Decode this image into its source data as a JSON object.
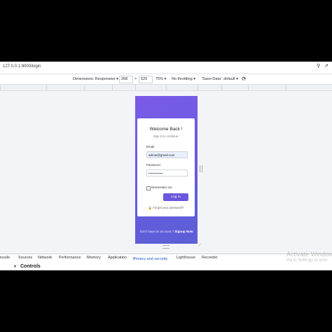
{
  "address_bar": {
    "url": "127.0.0.1:8000/login"
  },
  "device_toolbar": {
    "dimensions_label": "Dimensions: Responsive",
    "width": "268",
    "times": "×",
    "height": "626",
    "zoom": "75%",
    "throttling": "No throttling",
    "save_data": "'Save-Data': default"
  },
  "login": {
    "title": "Welcome Back !",
    "subtitle": "Sign in to continue.",
    "email_label": "Email",
    "email_value": "admin@gmail.com",
    "password_label": "Password",
    "password_value": "••••••••••",
    "remember_label": "Remember me",
    "login_button": "Log In",
    "forgot_link": "Forgot your password?",
    "signup_prompt": "Don't have an account ?",
    "signup_link": "Signup Now"
  },
  "devtools": {
    "tabs": [
      "onsole",
      "Sources",
      "Network",
      "Performance",
      "Memory",
      "Application",
      "Privacy and security",
      "Lighthouse",
      "Recorder"
    ],
    "active_tab": "Privacy and security",
    "close_glyph": "×",
    "panel_title": "Controls"
  },
  "watermark": {
    "line1": "Activate Window",
    "line2": "Go to Settings to activ"
  },
  "colors": {
    "gradient_start": "#7b5be6",
    "gradient_end": "#5b5fd6",
    "button": "#6a57de",
    "active_tab": "#1a57c9"
  }
}
